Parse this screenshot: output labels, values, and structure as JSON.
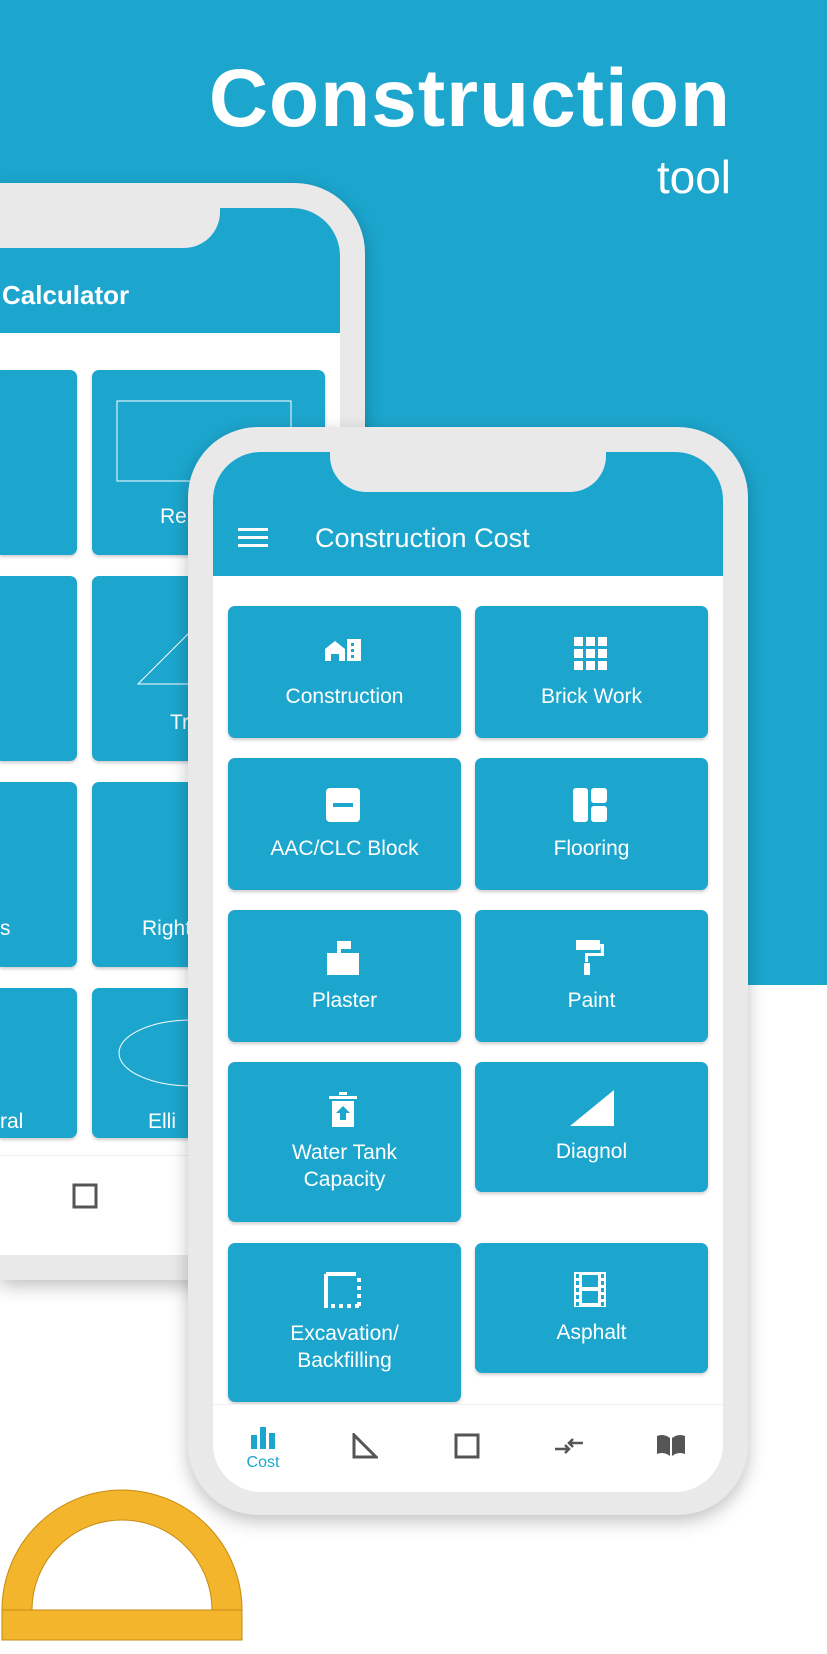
{
  "hero": {
    "title": "Construction",
    "subtitle": "tool"
  },
  "back_phone": {
    "title": "Calculator",
    "tiles": [
      "Re",
      "Tr",
      "s",
      "Right",
      "ral",
      "Elli"
    ]
  },
  "front_phone": {
    "title": "Construction Cost",
    "tiles": [
      {
        "label": "Construction",
        "icon": "building-icon"
      },
      {
        "label": "Brick Work",
        "icon": "grid-icon"
      },
      {
        "label": "AAC/CLC Block",
        "icon": "block-icon"
      },
      {
        "label": "Flooring",
        "icon": "flooring-icon"
      },
      {
        "label": "Plaster",
        "icon": "plaster-icon"
      },
      {
        "label": "Paint",
        "icon": "paint-roller-icon"
      },
      {
        "label": "Water Tank Capacity",
        "icon": "water-tank-icon"
      },
      {
        "label": "Diagnol",
        "icon": "triangle-icon"
      },
      {
        "label": "Excavation/ Backfilling",
        "icon": "excavation-icon"
      },
      {
        "label": "Asphalt",
        "icon": "film-icon"
      }
    ],
    "nav": [
      {
        "label": "Cost",
        "icon": "bar-chart-icon",
        "active": true
      },
      {
        "label": "",
        "icon": "set-square-icon"
      },
      {
        "label": "",
        "icon": "square-icon"
      },
      {
        "label": "",
        "icon": "convert-arrows-icon"
      },
      {
        "label": "",
        "icon": "book-icon"
      }
    ]
  },
  "colors": {
    "primary": "#1ca6ce",
    "frame": "#e9e9e9"
  }
}
